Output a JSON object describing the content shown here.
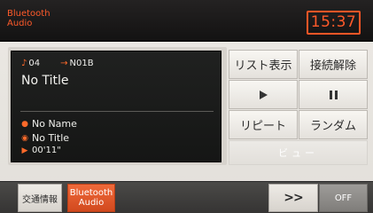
{
  "header": {
    "source_line1": "Bluetooth",
    "source_line2": "Audio",
    "clock": "15:37"
  },
  "now_playing": {
    "track_number": "04",
    "target": "N01B",
    "title": "No Title",
    "artist": "No Name",
    "album": "No Title",
    "elapsed": "00'11\""
  },
  "controls": {
    "list": "リスト表示",
    "disconnect": "接続解除",
    "repeat": "リピート",
    "random": "ランダム",
    "view": "ビュー"
  },
  "bottom_bar": {
    "traffic": "交通情報",
    "bt_line1": "Bluetooth",
    "bt_line2": "Audio",
    "next": ">>",
    "off": "OFF"
  },
  "colors": {
    "accent": "#ff5a2a",
    "active_tab": "#e0582a"
  },
  "icons": [
    "music-note-icon",
    "arrow-right-icon",
    "person-icon",
    "disc-icon",
    "play-small-icon",
    "play-icon",
    "pause-icon"
  ]
}
